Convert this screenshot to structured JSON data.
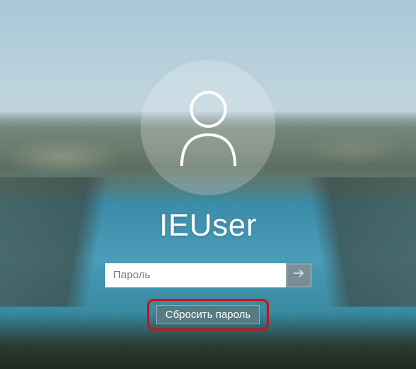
{
  "login": {
    "username": "IEUser",
    "password_placeholder": "Пароль",
    "password_value": "",
    "reset_label": "Сбросить пароль"
  },
  "icons": {
    "user": "user-icon",
    "submit_arrow": "arrow-right-icon"
  },
  "colors": {
    "highlight": "#c81414",
    "avatar_bg": "rgba(255,255,255,0.22)",
    "text": "#ffffff"
  }
}
